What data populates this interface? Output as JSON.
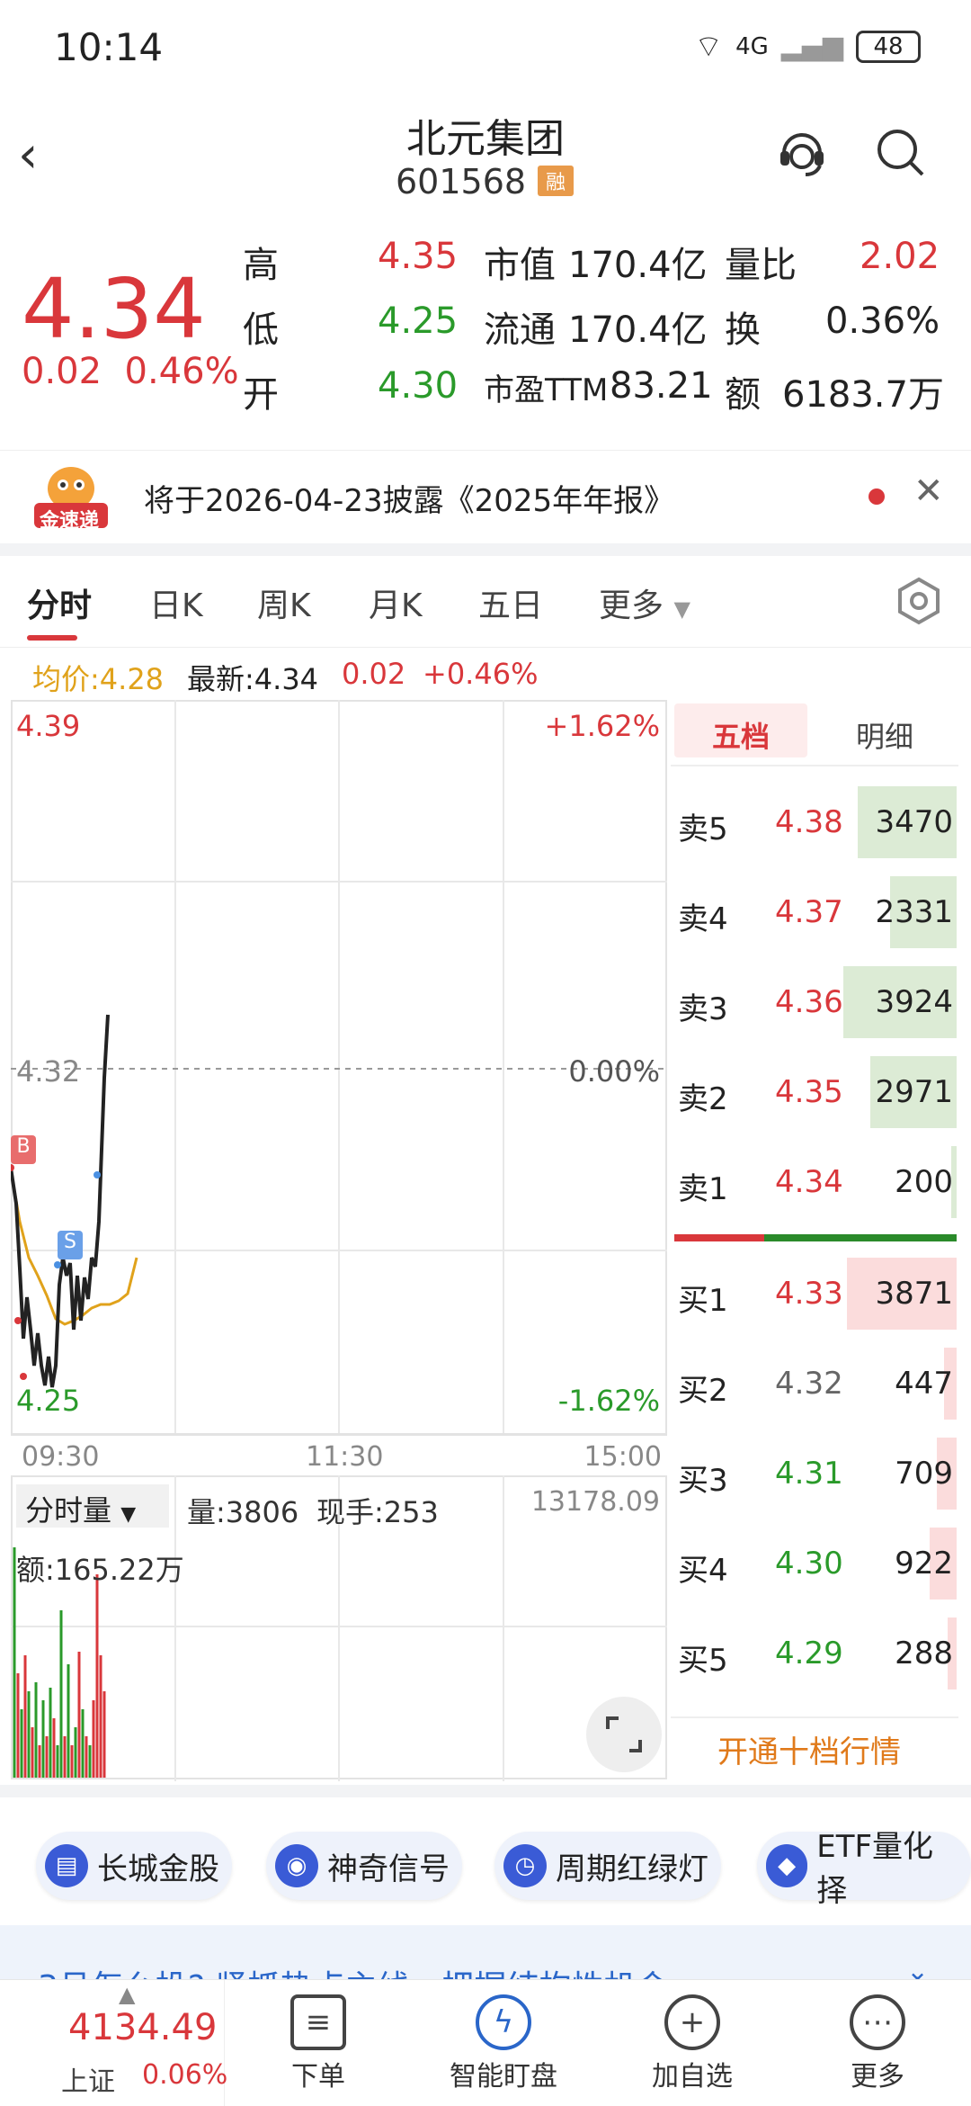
{
  "status_bar": {
    "time": "10:14",
    "network": "4G",
    "battery": "48"
  },
  "header": {
    "title": "北元集团",
    "code": "601568",
    "tag": "融"
  },
  "quote": {
    "price": "4.34",
    "change": "0.02",
    "change_pct": "0.46%",
    "rows": [
      [
        {
          "label": "高",
          "value": "4.35"
        },
        {
          "label": "市值",
          "value": "170.4亿"
        },
        {
          "label": "量比",
          "value": "2.02"
        }
      ],
      [
        {
          "label": "低",
          "value": "4.25"
        },
        {
          "label": "流通",
          "value": "170.4亿"
        },
        {
          "label": "换",
          "value": "0.36%"
        }
      ],
      [
        {
          "label": "开",
          "value": "4.30"
        },
        {
          "label": "市盈TTM",
          "value": "83.21"
        },
        {
          "label": "额",
          "value": "6183.7万"
        }
      ]
    ]
  },
  "notice": {
    "logo": "金速递",
    "text": "将于2026-04-23披露《2025年年报》"
  },
  "tabs": [
    "分时",
    "日K",
    "周K",
    "月K",
    "五日",
    "更多"
  ],
  "avg_line": {
    "avg": "均价:4.28",
    "latest": "最新:4.34",
    "chg": "0.02",
    "pct": "+0.46%"
  },
  "chart": {
    "y_top": "4.39",
    "y_mid": "4.32",
    "y_bottom": "4.25",
    "pct_top": "+1.62%",
    "pct_mid": "0.00%",
    "pct_bottom": "-1.62%",
    "x_labels": [
      "09:30",
      "11:30",
      "15:00"
    ],
    "markers": [
      "B",
      "S"
    ]
  },
  "volume": {
    "selector": "分时量",
    "amount": "量:3806",
    "current": "现手:253",
    "max": "13178.09",
    "sum": "额:165.22万"
  },
  "orderbook": {
    "tabs": [
      "五档",
      "明细"
    ],
    "asks": [
      {
        "label": "卖5",
        "price": "4.38",
        "vol": "3470"
      },
      {
        "label": "卖4",
        "price": "4.37",
        "vol": "2331"
      },
      {
        "label": "卖3",
        "price": "4.36",
        "vol": "3924"
      },
      {
        "label": "卖2",
        "price": "4.35",
        "vol": "2971"
      },
      {
        "label": "卖1",
        "price": "4.34",
        "vol": "200"
      }
    ],
    "bids": [
      {
        "label": "买1",
        "price": "4.33",
        "vol": "3871"
      },
      {
        "label": "买2",
        "price": "4.32",
        "vol": "447"
      },
      {
        "label": "买3",
        "price": "4.31",
        "vol": "709"
      },
      {
        "label": "买4",
        "price": "4.30",
        "vol": "922"
      },
      {
        "label": "买5",
        "price": "4.29",
        "vol": "288"
      }
    ],
    "open_ten": "开通十档行情"
  },
  "signals": [
    "长城金股",
    "神奇信号",
    "周期红绿灯",
    "ETF量化择"
  ],
  "banner_text": "3月怎么投? 紧抓热点主线，把握结构性机会",
  "bottom_nav": {
    "index_value": "4134.49",
    "index_name": "上证",
    "index_pct": "0.06%",
    "items": [
      "下单",
      "智能盯盘",
      "加自选",
      "更多"
    ]
  }
}
